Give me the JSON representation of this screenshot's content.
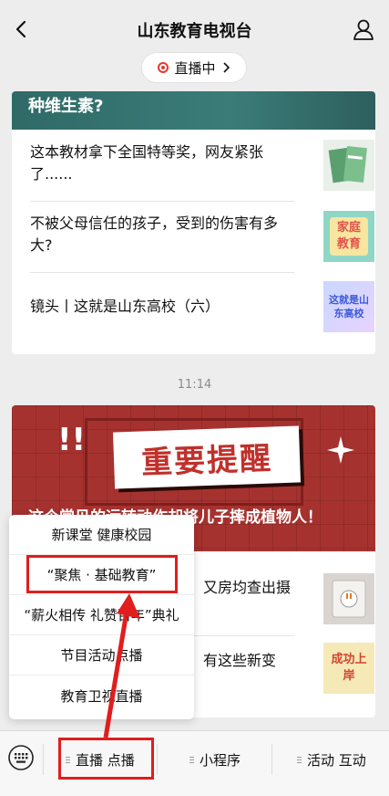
{
  "header": {
    "title": "山东教育电视台",
    "live_label": "直播中"
  },
  "card1": {
    "banner_text": "种维生素?",
    "items": [
      {
        "text": "这本教材拿下全国特等奖，网友紧张了......",
        "thumb_label": ""
      },
      {
        "text": "不被父母信任的孩子，受到的伤害有多大?",
        "thumb_label": "家庭教育"
      },
      {
        "text": "镜头丨这就是山东高校（六）",
        "thumb_label": "这就是山东高校"
      }
    ]
  },
  "timestamp": "11:14",
  "card2": {
    "hero_headline": "重要提醒",
    "hero_bang": "!!",
    "hero_caption": "这个常见的运转动作却将儿子摔成植物人！",
    "items": [
      {
        "text": "又房均查出摄",
        "thumb_label": ""
      },
      {
        "text": "有这些新变",
        "thumb_label": "成功上岸"
      }
    ]
  },
  "popup_menu": {
    "items": [
      "新课堂 健康校园",
      "“聚焦 · 基础教育”",
      "“薪火相传 礼赞百年”典礼",
      "节目活动点播",
      "教育卫视直播"
    ]
  },
  "menubar": {
    "items": [
      "直播 点播",
      "小程序",
      "活动 互动"
    ]
  },
  "colors": {
    "annotation_red": "#e11d1d",
    "live_red": "#e8392b",
    "banner_teal": "#3b7c78",
    "hero_red": "#a6322f"
  }
}
